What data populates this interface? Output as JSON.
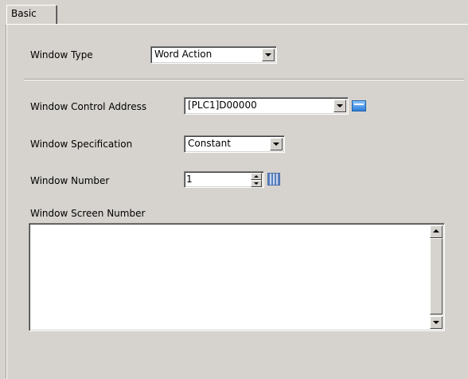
{
  "tab": {
    "label": "Basic"
  },
  "window_type": {
    "label": "Window Type",
    "value": "Word Action"
  },
  "control_address": {
    "label": "Window Control Address",
    "value": "[PLC1]D00000"
  },
  "specification": {
    "label": "Window Specification",
    "value": "Constant"
  },
  "window_number": {
    "label": "Window Number",
    "value": "1"
  },
  "screen_number": {
    "label": "Window Screen Number",
    "value": ""
  },
  "icons": {
    "address_input": "address-input-icon",
    "keypad": "keypad-icon"
  }
}
